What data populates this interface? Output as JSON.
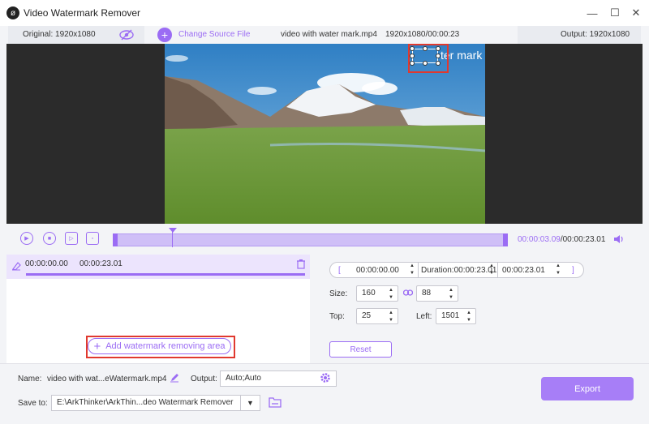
{
  "window": {
    "title": "Video Watermark Remover",
    "minimize": "—",
    "maximize": "☐",
    "close": "✕"
  },
  "info": {
    "original": "Original: 1920x1080",
    "change_source": "Change Source File",
    "filename": "video with water mark.mp4",
    "resolution_duration": "1920x1080/00:00:23",
    "output": "Output: 1920x1080"
  },
  "video": {
    "watermark_text": "ter mark"
  },
  "controls": {
    "current_time": "00:00:03.09",
    "total_time": "/00:00:23.01"
  },
  "segment": {
    "start": "00:00:00.00",
    "end": "00:00:23.01"
  },
  "add_area": {
    "label": "Add watermark removing area"
  },
  "timecode": {
    "open": "[",
    "start": "00:00:00.00",
    "duration": "Duration:00:00:23.01",
    "end": "00:00:23.01",
    "close": "]"
  },
  "size": {
    "label": "Size:",
    "width": "160",
    "height": "88"
  },
  "position": {
    "top_label": "Top:",
    "top": "25",
    "left_label": "Left:",
    "left": "1501"
  },
  "reset": "Reset",
  "bottom": {
    "name_label": "Name:",
    "name_value": "video with wat...eWatermark.mp4",
    "output_label": "Output:",
    "output_value": "Auto;Auto",
    "save_label": "Save to:",
    "save_value": "E:\\ArkThinker\\ArkThin...deo Watermark Remover",
    "export": "Export"
  },
  "colors": {
    "accent": "#9b6cf4",
    "highlight": "#e0392f"
  }
}
